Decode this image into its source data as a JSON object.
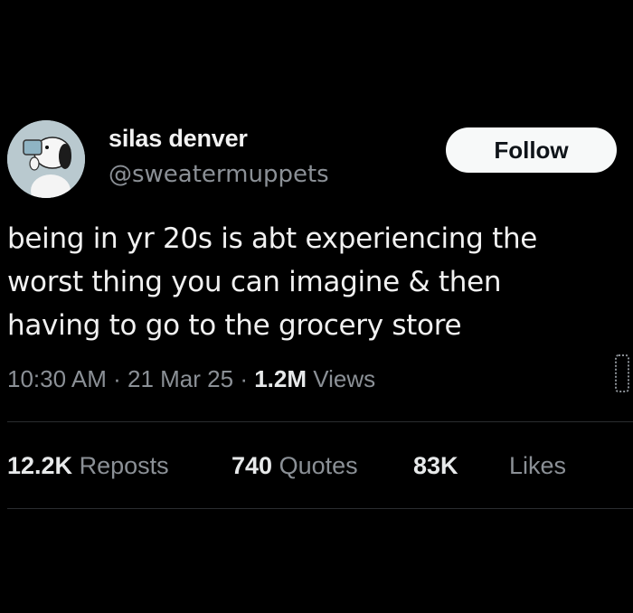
{
  "user": {
    "display_name": "silas denver",
    "handle": "@sweatermuppets",
    "avatar_icon": "snoopy-drinking-avatar"
  },
  "follow_label": "Follow",
  "tweet": {
    "text_lines": [
      "being in yr 20s is abt experiencing the",
      "worst thing you can imagine & then",
      "having to go to the grocery store"
    ],
    "time": "10:30 AM",
    "separator": "·",
    "date": "21 Mar 25",
    "views_count": "1.2M",
    "views_label": "Views"
  },
  "stats": {
    "reposts_count": "12.2K",
    "reposts_label": "Reposts",
    "quotes_count": "740",
    "quotes_label": "Quotes",
    "likes_count": "83K",
    "likes_label": "Likes"
  },
  "colors": {
    "background": "#000000",
    "text_primary": "#e7e9ea",
    "text_secondary": "#8b9096",
    "follow_bg": "#f7f9f9",
    "follow_text": "#0f1419"
  }
}
